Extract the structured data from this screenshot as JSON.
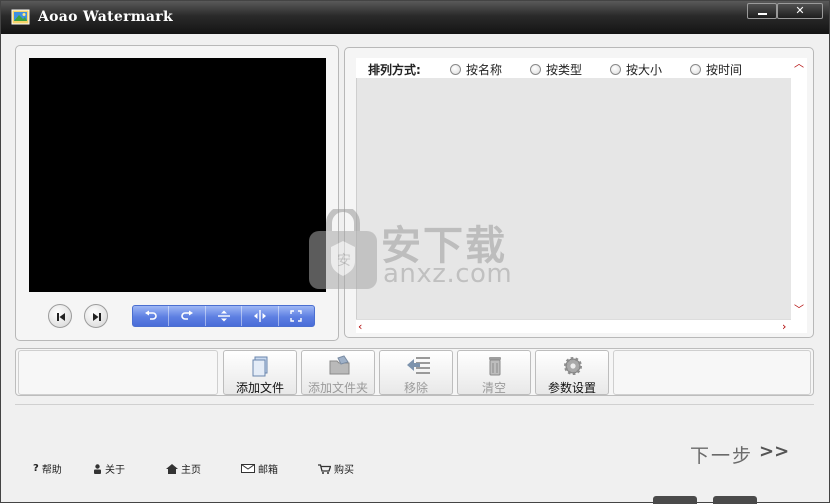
{
  "window": {
    "title": "Aoao Watermark",
    "close_glyph": "✕",
    "accent": "#4a6dd8"
  },
  "preview": {
    "prev_icon": "skip-back-icon",
    "next_icon": "skip-forward-icon",
    "tools": [
      "rotate-left-icon",
      "rotate-right-icon",
      "flip-vertical-icon",
      "flip-horizontal-icon",
      "fit-screen-icon"
    ]
  },
  "sort": {
    "label": "排列方式:",
    "options": [
      "按名称",
      "按类型",
      "按大小",
      "按时间"
    ]
  },
  "watermark": {
    "cn": "安下载",
    "en": "anxz.com"
  },
  "actions": [
    {
      "label": "添加文件",
      "icon": "add-file-icon",
      "enabled": true
    },
    {
      "label": "添加文件夹",
      "icon": "add-folder-icon",
      "enabled": false
    },
    {
      "label": "移除",
      "icon": "remove-icon",
      "enabled": false
    },
    {
      "label": "清空",
      "icon": "clear-icon",
      "enabled": false
    },
    {
      "label": "参数设置",
      "icon": "settings-icon",
      "enabled": true
    }
  ],
  "links": [
    {
      "label": "帮助",
      "icon": "help-icon"
    },
    {
      "label": "关于",
      "icon": "about-icon"
    },
    {
      "label": "主页",
      "icon": "home-icon"
    },
    {
      "label": "邮箱",
      "icon": "mail-icon"
    },
    {
      "label": "购买",
      "icon": "cart-icon"
    }
  ],
  "next": {
    "label": "下一步",
    "arrows": ">>"
  }
}
